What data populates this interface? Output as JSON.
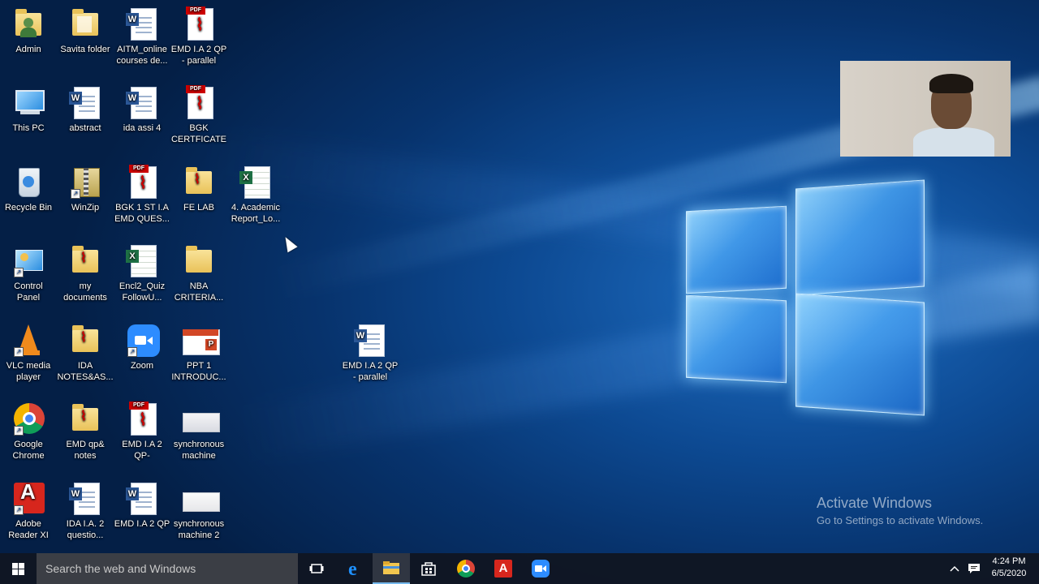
{
  "desktop": {
    "icons": [
      {
        "label": "Admin"
      },
      {
        "label": "Savita folder"
      },
      {
        "label": "AITM_online\ncourses de..."
      },
      {
        "label": "EMD I.A 2 QP\n- parallel"
      },
      {
        "label": "This PC"
      },
      {
        "label": "abstract"
      },
      {
        "label": "ida assi 4"
      },
      {
        "label": "BGK\nCERTFICATE"
      },
      {
        "label": "Recycle Bin"
      },
      {
        "label": "WinZip"
      },
      {
        "label": "BGK 1 ST I.A\nEMD QUES..."
      },
      {
        "label": "FE LAB"
      },
      {
        "label": "4. Academic\nReport_Lo..."
      },
      {
        "label": "Control\nPanel"
      },
      {
        "label": "my\ndocuments"
      },
      {
        "label": "Encl2_Quiz\nFollowU..."
      },
      {
        "label": "NBA\nCRITERIA..."
      },
      {
        "label": "VLC media\nplayer"
      },
      {
        "label": "IDA\nNOTES&AS..."
      },
      {
        "label": "Zoom"
      },
      {
        "label": "PPT 1\nINTRODUC..."
      },
      {
        "label": "Google\nChrome"
      },
      {
        "label": "EMD qp&\nnotes"
      },
      {
        "label": "EMD I.A 2\nQP-"
      },
      {
        "label": "synchronous\nmachine"
      },
      {
        "label": "Adobe\nReader XI"
      },
      {
        "label": "IDA I.A. 2\nquestio..."
      },
      {
        "label": "EMD I.A 2 QP"
      },
      {
        "label": "synchronous\nmachine 2"
      },
      {
        "label": "EMD I.A 2 QP\n- parallel"
      }
    ]
  },
  "watermark": {
    "title": "Activate Windows",
    "subtitle": "Go to Settings to activate Windows."
  },
  "taskbar": {
    "search_placeholder": "Search the web and Windows",
    "time": "4:24 PM",
    "date": "6/5/2020"
  },
  "colors": {
    "accent": "#76b9ed",
    "taskbar_bg": "#10161f"
  }
}
